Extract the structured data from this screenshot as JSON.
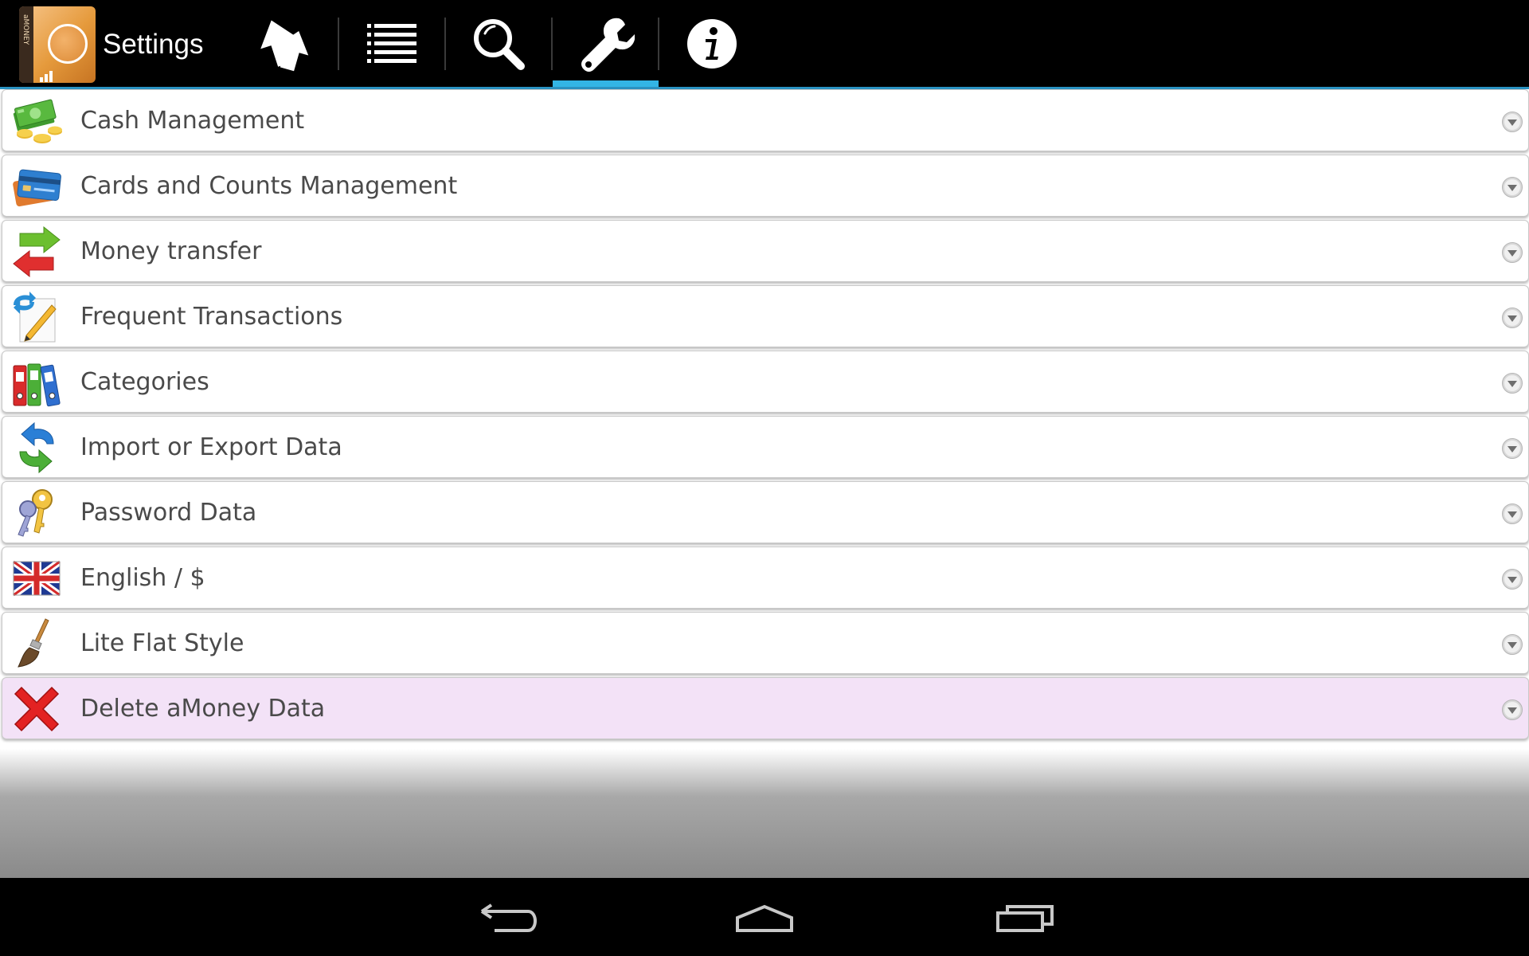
{
  "action_bar": {
    "app_name": "Settings",
    "app_icon_spine_text": "aMONEY",
    "tabs": [
      {
        "id": "sync",
        "icon": "sync-arrows-icon",
        "selected": false
      },
      {
        "id": "list",
        "icon": "list-icon",
        "selected": false
      },
      {
        "id": "search",
        "icon": "search-icon",
        "selected": false
      },
      {
        "id": "settings",
        "icon": "wrench-icon",
        "selected": true
      },
      {
        "id": "info",
        "icon": "info-icon",
        "selected": false
      }
    ],
    "accent_color": "#33b5e5"
  },
  "settings": {
    "items": [
      {
        "label": "Cash Management",
        "icon": "cash-icon"
      },
      {
        "label": "Cards and Counts Management",
        "icon": "credit-cards-icon"
      },
      {
        "label": "Money transfer",
        "icon": "transfer-arrows-icon"
      },
      {
        "label": "Frequent Transactions",
        "icon": "recurring-note-icon"
      },
      {
        "label": "Categories",
        "icon": "binders-icon"
      },
      {
        "label": "Import or Export Data",
        "icon": "import-export-icon"
      },
      {
        "label": "Password Data",
        "icon": "keys-icon"
      },
      {
        "label": "English / $",
        "icon": "uk-flag-icon"
      },
      {
        "label": "Lite Flat Style",
        "icon": "paintbrush-icon"
      },
      {
        "label": "Delete aMoney Data",
        "icon": "red-x-icon"
      }
    ],
    "danger_row_color": "#f3e2f7"
  },
  "nav_bar": {
    "buttons": [
      "back-icon",
      "home-icon",
      "recent-apps-icon"
    ]
  }
}
